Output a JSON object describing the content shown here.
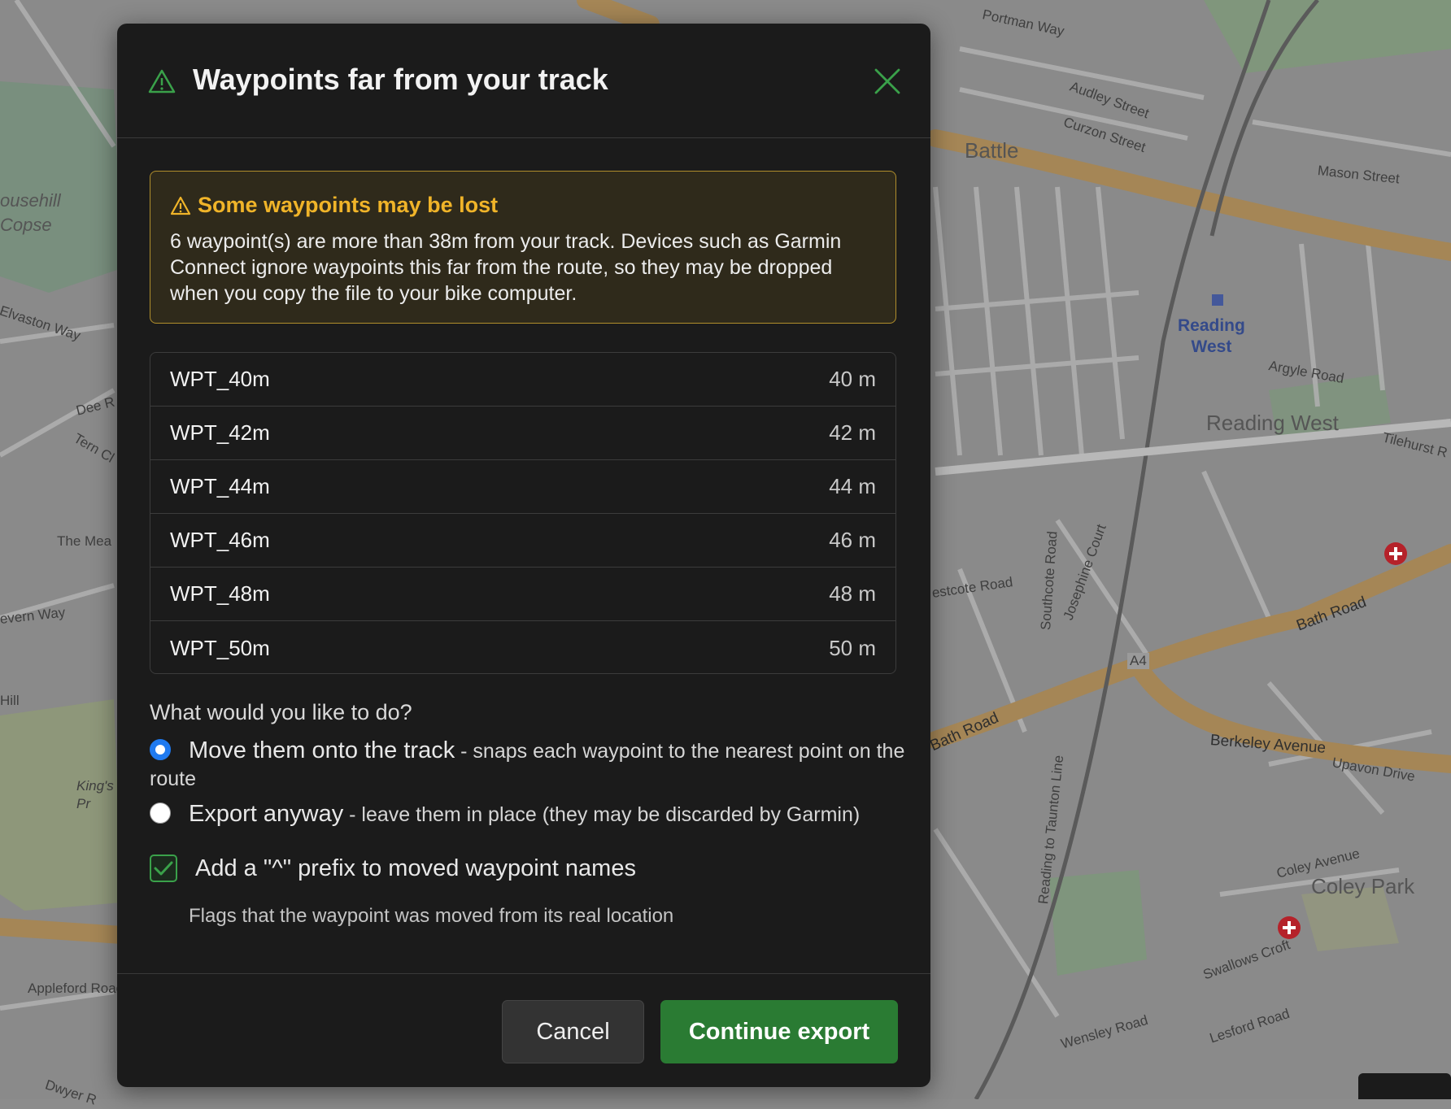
{
  "dialog": {
    "title": "Waypoints far from your track",
    "alert": {
      "heading": "Some waypoints may be lost",
      "body": "6 waypoint(s) are more than 38m from your track. Devices such as Garmin Connect ignore waypoints this far from the route, so they may be dropped when you copy the file to your bike computer."
    },
    "waypoints": [
      {
        "name": "WPT_40m",
        "distance": "40 m"
      },
      {
        "name": "WPT_42m",
        "distance": "42 m"
      },
      {
        "name": "WPT_44m",
        "distance": "44 m"
      },
      {
        "name": "WPT_46m",
        "distance": "46 m"
      },
      {
        "name": "WPT_48m",
        "distance": "48 m"
      },
      {
        "name": "WPT_50m",
        "distance": "50 m"
      }
    ],
    "question": "What would you like to do?",
    "options": [
      {
        "title": "Move them onto the track",
        "description": " - snaps each waypoint to the nearest point on the route",
        "selected": true
      },
      {
        "title": "Export anyway",
        "description": " - leave them in place (they may be discarded by Garmin)",
        "selected": false
      }
    ],
    "prefix_checkbox": {
      "label": "Add a \"^\" prefix to moved waypoint names",
      "help": "Flags that the waypoint was moved from its real location",
      "checked": true
    },
    "buttons": {
      "cancel": "Cancel",
      "continue": "Continue export"
    }
  },
  "map": {
    "labels": {
      "battle": "Battle",
      "reading_west_station": "Reading\nWest",
      "reading_west_area": "Reading West",
      "coley_park": "Coley Park",
      "bath_road_e": "Bath Road",
      "bath_road_w": "Bath Road",
      "berkeley_avenue": "Berkeley Avenue",
      "a4": "A4",
      "portman_way": "Portman Way",
      "audley_street": "Audley Street",
      "curzon_street": "Curzon Street",
      "mason_street": "Mason Street",
      "argyle_road": "Argyle Road",
      "tilehurst_road": "Tilehurst R",
      "upavon_drive": "Upavon Drive",
      "coley_avenue": "Coley Avenue",
      "swallows_croft": "Swallows Croft",
      "wensley_road": "Wensley Road",
      "lesford_road": "Lesford Road",
      "westcote_road": "estcote Road",
      "josephine_court": "Josephine Court",
      "southcote_road": "Southcote Road",
      "reading_taunton_line": "Reading to Taunton Line",
      "househill_copse": "ousehill\nCopse",
      "elvaston_way": "Elvaston Way",
      "the_mead": "The Mea",
      "severn_way": "evern Way",
      "appleford_road": "Appleford Road",
      "kings": "King's\nPr",
      "dee_road": "Dee R",
      "tern_close": "Tern Cl",
      "hill": "Hill",
      "dwyer": "Dwyer R"
    },
    "colors": {
      "land": "#8c8c8c",
      "major_road": "#a08253",
      "minor_road": "#b5b5b5",
      "park": "#6f8a6a",
      "rail": "#555555",
      "hospital": "#b5222a"
    }
  }
}
